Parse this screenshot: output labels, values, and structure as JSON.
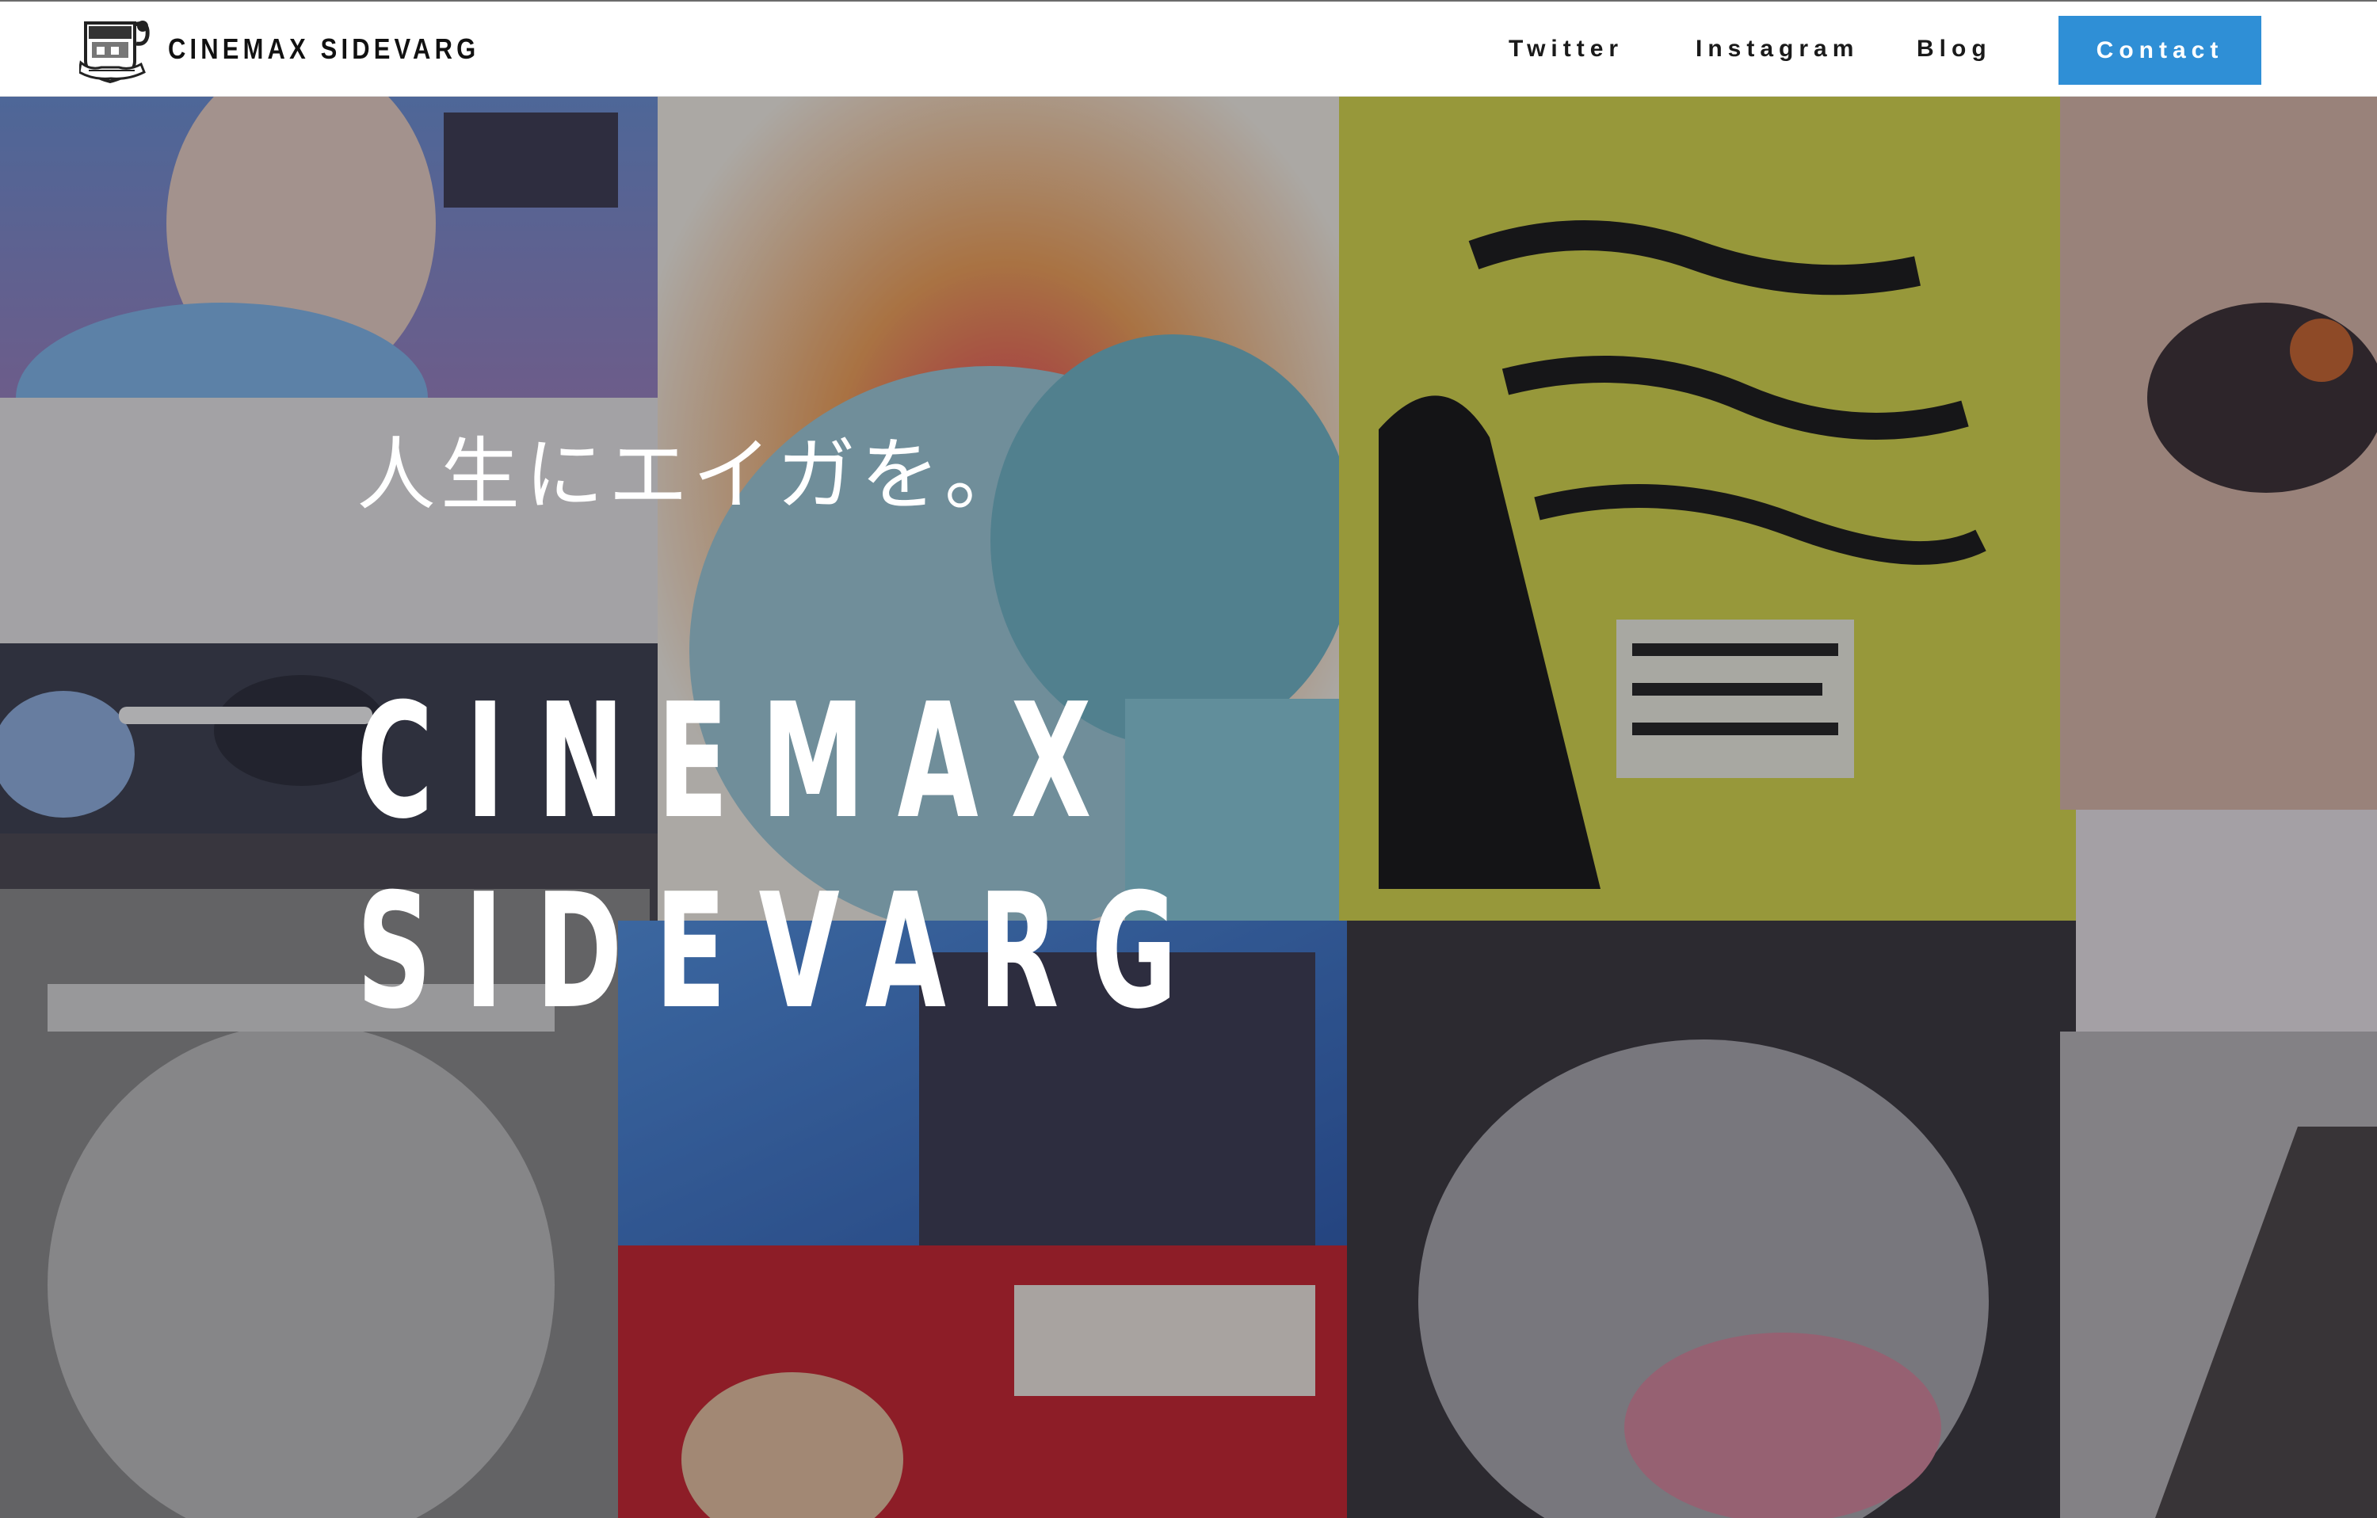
{
  "header": {
    "brand_name": "CINEMAX SIDEVARG",
    "logo_icon": "cinema-crest-logo-icon",
    "nav": [
      {
        "label": "Twitter"
      },
      {
        "label": "Instagram"
      },
      {
        "label": "Blog"
      }
    ],
    "contact_label": "Contact"
  },
  "hero": {
    "tagline": "人生にエイガを。",
    "title_line1": "CINEMAX",
    "title_line2": "SIDEVARG",
    "background": "collage of vintage film posters (dimmed)"
  },
  "colors": {
    "accent": "#2f8fd6",
    "header_bg": "#ffffff",
    "hero_text": "#ffffff"
  }
}
